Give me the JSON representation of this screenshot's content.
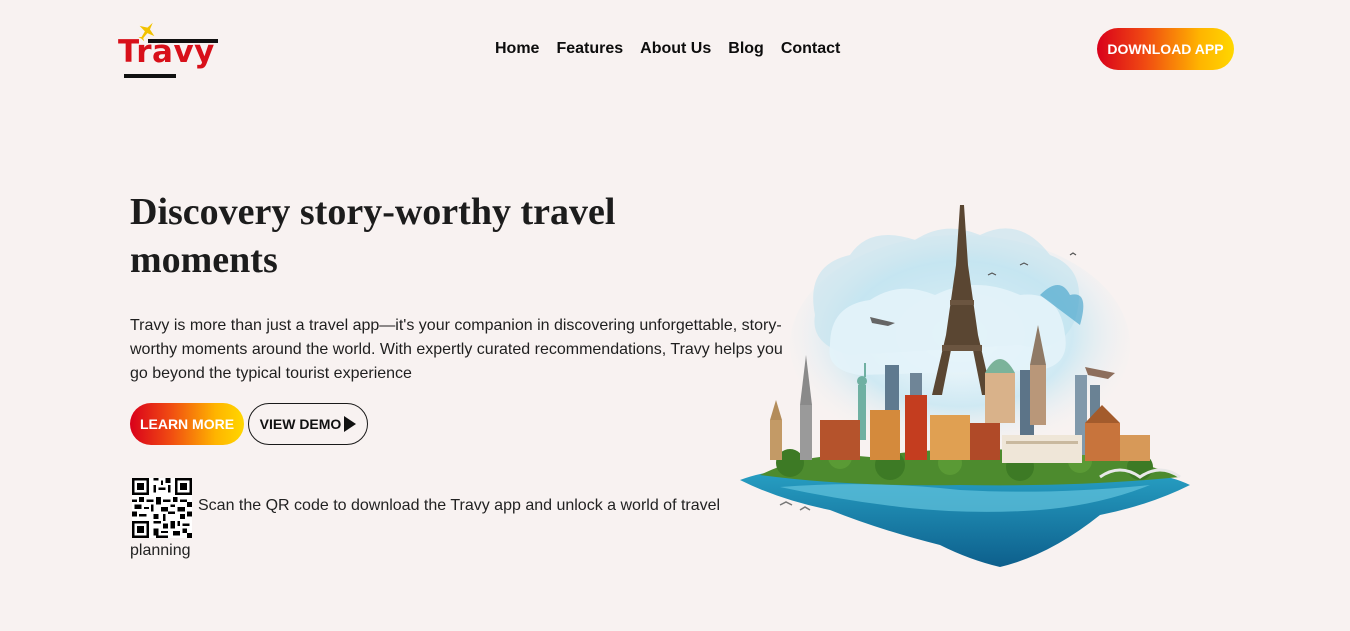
{
  "brand": {
    "name": "Travy",
    "primary": "#d8101a",
    "accent": "#ffd700"
  },
  "nav": {
    "items": [
      {
        "label": "Home"
      },
      {
        "label": "Features"
      },
      {
        "label": "About Us"
      },
      {
        "label": "Blog"
      },
      {
        "label": "Contact"
      }
    ],
    "cta_label": "DOWNLOAD APP"
  },
  "hero": {
    "title": "Discovery story-worthy travel moments",
    "description": "Travy is more than just a travel app—it's your companion in discovering unforgettable, story-worthy moments around the world. With expertly curated recommendations, Travy helps you go beyond the typical tourist experience",
    "learn_more_label": "LEARN MORE",
    "view_demo_label": "VIEW DEMO",
    "qr_text_line1": "Scan the QR code to download the Travy app and unlock a world of travel",
    "qr_text_line2": "planning",
    "image": "travel-landmarks-island-illustration"
  },
  "icons": {
    "plane": "plane-icon",
    "play": "play-icon",
    "qr": "qr-code-icon"
  }
}
